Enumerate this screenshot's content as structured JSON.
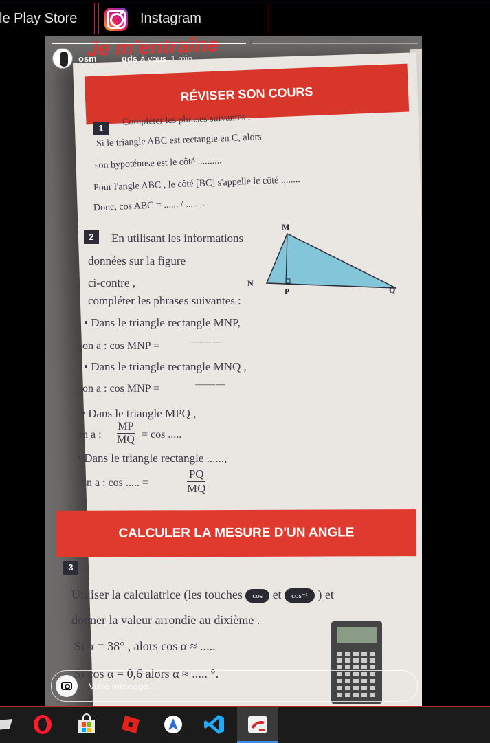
{
  "tabs": [
    {
      "label": "le Play Store"
    },
    {
      "label": "Instagram"
    }
  ],
  "story": {
    "username": "osm_____qds",
    "audience": "à vous",
    "time": "1 min.",
    "message_placeholder": "Votre message..."
  },
  "page": {
    "header_partial": "Je m'entraîne",
    "banner1": "RÉVISER SON COURS",
    "ex1": {
      "num": "1",
      "lines": [
        "Compléter les phrases suivantes :",
        "Si le triangle ABC est rectangle en C, alors",
        "son hypoténuse est le côté ..........",
        "Pour l'angle ABC , le côté [BC] s'appelle le côté ........",
        "Donc, cos ABC = ...... / ...... ."
      ]
    },
    "ex2": {
      "num": "2",
      "lines": [
        "En utilisant les informations",
        "données sur la   figure",
        "ci-contre ,",
        "compléter les phrases suivantes :",
        "• Dans le triangle rectangle MNP,",
        "on a : cos MNP =",
        "• Dans le triangle rectangle MNQ ,",
        "on a : cos MNP =",
        "• Dans le triangle MPQ ,",
        "on a :",
        "= cos .....",
        "• Dans le triangle rectangle ......,",
        "on a :    cos ..... ="
      ],
      "frac1_num": "MP",
      "frac1_den": "MQ",
      "frac2_num": "PQ",
      "frac2_den": "MQ",
      "points": [
        "M",
        "N",
        "P",
        "Q"
      ]
    },
    "banner2": "CALCULER LA MESURE D'UN ANGLE",
    "ex3": {
      "num": "3",
      "lines": [
        "Utiliser la calculatrice (les touches",
        "et",
        ") et",
        "donner la valeur arrondie au dixième .",
        "Si α = 38° ,  alors   cos α  ≈ .....",
        "Si cos α = 0,6   alors    α ≈ ..... °."
      ],
      "key1": "cos",
      "key2": "cos⁻¹"
    }
  },
  "taskbar": {
    "icons": [
      "start-icon",
      "opera-icon",
      "store-icon",
      "roblox-icon",
      "maps-icon",
      "vscode-icon",
      "app-active-icon"
    ]
  },
  "colors": {
    "accent_red": "#d9362b",
    "tab_border": "#c0202a"
  }
}
